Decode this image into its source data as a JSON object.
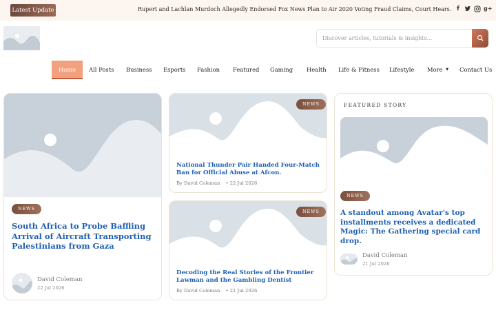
{
  "topbar": {
    "latest_label": "Latest Update",
    "ticker_text": "Rupert and Lachlan Murdoch Allegedly Endorsed Fox News Plan to Air 2020 Voting Fraud Claims, Court Hears.",
    "social": [
      "f",
      "t",
      "ig",
      "g+"
    ]
  },
  "search": {
    "placeholder": "Discover articles, tutorials & insights..."
  },
  "nav": {
    "home": "Home",
    "all_posts": "All Posts",
    "business": "Business",
    "esports": "Esports",
    "fashion": "Fashion",
    "featured": "Featured",
    "gaming": "Gaming",
    "health": "Health",
    "life_fitness": "Life & Fitness",
    "lifestyle": "Lifestyle",
    "more": "More",
    "contact": "Contact Us"
  },
  "main_post": {
    "badge": "NEWS",
    "title": "South Africa to Probe Baffling Arrival of Aircraft Transporting Palestinians from Gaza",
    "author": "David Coleman",
    "date": "22 Jul 2026"
  },
  "post_two": {
    "badge": "NEWS",
    "title": "National Thunder Pair Handed Four-Match Ban for Official Abuse at Afcon.",
    "author": "By David Coleman",
    "date": "22 Jul 2026"
  },
  "post_three": {
    "badge": "NEWS",
    "title": "Decoding the Real Stories of the Frontier Lawman and the Gambling Dentist",
    "author": "By David Coleman",
    "date": "21 Jul 2026"
  },
  "featured": {
    "label": "FEATURED STORY",
    "badge": "NEWS",
    "title": "A standout among Avatar's top installments receives a dedicated Magic: The Gathering special card drop.",
    "author": "David Coleman",
    "date": "21 Jul 2026"
  },
  "colors": {
    "accent": "#f3a07e",
    "badge": "#8a5a47",
    "link": "#1f5fb4",
    "topbar_bg": "#fdf5ef"
  }
}
